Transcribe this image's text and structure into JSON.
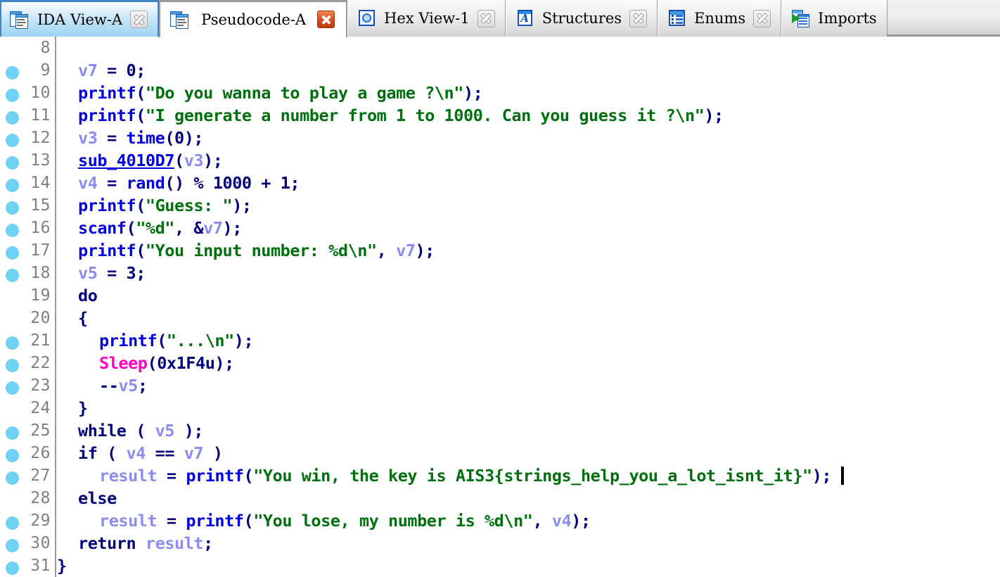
{
  "app": {
    "name": "IDA Pro disassembler",
    "active_tab": "Pseudocode-A"
  },
  "tabs": [
    {
      "id": "ida-view-a",
      "label": "IDA View-A",
      "icon": "document-stack-icon",
      "state": "hover",
      "close_style": "grey",
      "has_close": true
    },
    {
      "id": "pseudocode-a",
      "label": "Pseudocode-A",
      "icon": "document-stack-icon",
      "state": "active",
      "close_style": "red",
      "has_close": true
    },
    {
      "id": "hex-view-1",
      "label": "Hex View-1",
      "icon": "hex-view-icon",
      "state": "inactive",
      "close_style": "grey",
      "has_close": true
    },
    {
      "id": "structures",
      "label": "Structures",
      "icon": "structures-icon",
      "state": "inactive",
      "close_style": "grey",
      "has_close": true
    },
    {
      "id": "enums",
      "label": "Enums",
      "icon": "enums-icon",
      "state": "inactive",
      "close_style": "grey",
      "has_close": true
    },
    {
      "id": "imports",
      "label": "Imports",
      "icon": "imports-icon",
      "state": "inactive",
      "close_style": "grey",
      "has_close": false
    }
  ],
  "colors": {
    "keyword": "#00007f",
    "function": "#0000e0",
    "string": "#00700f",
    "variable": "#8c8cf0",
    "api_import": "#ff00c0",
    "line_number": "#808080",
    "breakpoint_dot": "#6fd2f5",
    "background": "#ffffff"
  },
  "editor": {
    "caret_visible": true,
    "caret_line": 27,
    "first_visible_line": 8,
    "last_visible_line": 31
  },
  "code_lines": [
    {
      "num": "8",
      "dot": false,
      "indent": 0,
      "tokens": []
    },
    {
      "num": "9",
      "dot": true,
      "indent": 2,
      "tokens": [
        {
          "t": "v7",
          "c": "c-var"
        },
        {
          "t": " = ",
          "c": "c-punct"
        },
        {
          "t": "0",
          "c": "c-num"
        },
        {
          "t": ";",
          "c": "c-punct"
        }
      ]
    },
    {
      "num": "10",
      "dot": true,
      "indent": 2,
      "tokens": [
        {
          "t": "printf",
          "c": "c-func"
        },
        {
          "t": "(",
          "c": "c-punct"
        },
        {
          "t": "\"Do you wanna to play a game ?\\n\"",
          "c": "c-str"
        },
        {
          "t": ");",
          "c": "c-punct"
        }
      ]
    },
    {
      "num": "11",
      "dot": true,
      "indent": 2,
      "tokens": [
        {
          "t": "printf",
          "c": "c-func"
        },
        {
          "t": "(",
          "c": "c-punct"
        },
        {
          "t": "\"I generate a number from 1 to 1000. Can you guess it ?\\n\"",
          "c": "c-str"
        },
        {
          "t": ");",
          "c": "c-punct"
        }
      ]
    },
    {
      "num": "12",
      "dot": true,
      "indent": 2,
      "tokens": [
        {
          "t": "v3",
          "c": "c-var"
        },
        {
          "t": " = ",
          "c": "c-punct"
        },
        {
          "t": "time",
          "c": "c-func"
        },
        {
          "t": "(",
          "c": "c-punct"
        },
        {
          "t": "0",
          "c": "c-num"
        },
        {
          "t": ");",
          "c": "c-punct"
        }
      ]
    },
    {
      "num": "13",
      "dot": true,
      "indent": 2,
      "tokens": [
        {
          "t": "sub_4010D7",
          "c": "c-subr"
        },
        {
          "t": "(",
          "c": "c-punct"
        },
        {
          "t": "v3",
          "c": "c-var"
        },
        {
          "t": ");",
          "c": "c-punct"
        }
      ]
    },
    {
      "num": "14",
      "dot": true,
      "indent": 2,
      "tokens": [
        {
          "t": "v4",
          "c": "c-var"
        },
        {
          "t": " = ",
          "c": "c-punct"
        },
        {
          "t": "rand",
          "c": "c-func"
        },
        {
          "t": "() % ",
          "c": "c-punct"
        },
        {
          "t": "1000",
          "c": "c-num"
        },
        {
          "t": " + ",
          "c": "c-punct"
        },
        {
          "t": "1",
          "c": "c-num"
        },
        {
          "t": ";",
          "c": "c-punct"
        }
      ]
    },
    {
      "num": "15",
      "dot": true,
      "indent": 2,
      "tokens": [
        {
          "t": "printf",
          "c": "c-func"
        },
        {
          "t": "(",
          "c": "c-punct"
        },
        {
          "t": "\"Guess: \"",
          "c": "c-str"
        },
        {
          "t": ");",
          "c": "c-punct"
        }
      ]
    },
    {
      "num": "16",
      "dot": true,
      "indent": 2,
      "tokens": [
        {
          "t": "scanf",
          "c": "c-func"
        },
        {
          "t": "(",
          "c": "c-punct"
        },
        {
          "t": "\"%d\"",
          "c": "c-str"
        },
        {
          "t": ", &",
          "c": "c-punct"
        },
        {
          "t": "v7",
          "c": "c-var"
        },
        {
          "t": ");",
          "c": "c-punct"
        }
      ]
    },
    {
      "num": "17",
      "dot": true,
      "indent": 2,
      "tokens": [
        {
          "t": "printf",
          "c": "c-func"
        },
        {
          "t": "(",
          "c": "c-punct"
        },
        {
          "t": "\"You input number: %d\\n\"",
          "c": "c-str"
        },
        {
          "t": ", ",
          "c": "c-punct"
        },
        {
          "t": "v7",
          "c": "c-var"
        },
        {
          "t": ");",
          "c": "c-punct"
        }
      ]
    },
    {
      "num": "18",
      "dot": true,
      "indent": 2,
      "tokens": [
        {
          "t": "v5",
          "c": "c-var"
        },
        {
          "t": " = ",
          "c": "c-punct"
        },
        {
          "t": "3",
          "c": "c-num"
        },
        {
          "t": ";",
          "c": "c-punct"
        }
      ]
    },
    {
      "num": "19",
      "dot": false,
      "indent": 2,
      "tokens": [
        {
          "t": "do",
          "c": "c-kw"
        }
      ]
    },
    {
      "num": "20",
      "dot": false,
      "indent": 2,
      "tokens": [
        {
          "t": "{",
          "c": "c-punct"
        }
      ]
    },
    {
      "num": "21",
      "dot": true,
      "indent": 4,
      "tokens": [
        {
          "t": "printf",
          "c": "c-func"
        },
        {
          "t": "(",
          "c": "c-punct"
        },
        {
          "t": "\"...\\n\"",
          "c": "c-str"
        },
        {
          "t": ");",
          "c": "c-punct"
        }
      ]
    },
    {
      "num": "22",
      "dot": true,
      "indent": 4,
      "tokens": [
        {
          "t": "Sleep",
          "c": "c-api"
        },
        {
          "t": "(",
          "c": "c-punct"
        },
        {
          "t": "0x1F4u",
          "c": "c-num"
        },
        {
          "t": ");",
          "c": "c-punct"
        }
      ]
    },
    {
      "num": "23",
      "dot": true,
      "indent": 4,
      "tokens": [
        {
          "t": "--",
          "c": "c-punct"
        },
        {
          "t": "v5",
          "c": "c-var"
        },
        {
          "t": ";",
          "c": "c-punct"
        }
      ]
    },
    {
      "num": "24",
      "dot": false,
      "indent": 2,
      "tokens": [
        {
          "t": "}",
          "c": "c-punct"
        }
      ]
    },
    {
      "num": "25",
      "dot": true,
      "indent": 2,
      "tokens": [
        {
          "t": "while",
          "c": "c-kw"
        },
        {
          "t": " ( ",
          "c": "c-punct"
        },
        {
          "t": "v5",
          "c": "c-var"
        },
        {
          "t": " );",
          "c": "c-punct"
        }
      ]
    },
    {
      "num": "26",
      "dot": true,
      "indent": 2,
      "tokens": [
        {
          "t": "if",
          "c": "c-kw"
        },
        {
          "t": " ( ",
          "c": "c-punct"
        },
        {
          "t": "v4",
          "c": "c-var"
        },
        {
          "t": " == ",
          "c": "c-punct"
        },
        {
          "t": "v7",
          "c": "c-var"
        },
        {
          "t": " )",
          "c": "c-punct"
        }
      ]
    },
    {
      "num": "27",
      "dot": true,
      "indent": 4,
      "tokens": [
        {
          "t": "result",
          "c": "c-var"
        },
        {
          "t": " = ",
          "c": "c-punct"
        },
        {
          "t": "printf",
          "c": "c-func"
        },
        {
          "t": "(",
          "c": "c-punct"
        },
        {
          "t": "\"You win, the key is AIS3{strings_help_you_a_lot_isnt_it}\"",
          "c": "c-str"
        },
        {
          "t": ");",
          "c": "c-punct"
        }
      ]
    },
    {
      "num": "28",
      "dot": false,
      "indent": 2,
      "tokens": [
        {
          "t": "else",
          "c": "c-kw"
        }
      ]
    },
    {
      "num": "29",
      "dot": true,
      "indent": 4,
      "tokens": [
        {
          "t": "result",
          "c": "c-var"
        },
        {
          "t": " = ",
          "c": "c-punct"
        },
        {
          "t": "printf",
          "c": "c-func"
        },
        {
          "t": "(",
          "c": "c-punct"
        },
        {
          "t": "\"You lose, my number is %d\\n\"",
          "c": "c-str"
        },
        {
          "t": ", ",
          "c": "c-punct"
        },
        {
          "t": "v4",
          "c": "c-var"
        },
        {
          "t": ");",
          "c": "c-punct"
        }
      ]
    },
    {
      "num": "30",
      "dot": true,
      "indent": 2,
      "tokens": [
        {
          "t": "return",
          "c": "c-kw"
        },
        {
          "t": " ",
          "c": "c-punct"
        },
        {
          "t": "result",
          "c": "c-var"
        },
        {
          "t": ";",
          "c": "c-punct"
        }
      ]
    },
    {
      "num": "31",
      "dot": true,
      "indent": 0,
      "tokens": [
        {
          "t": "}",
          "c": "c-punct"
        }
      ]
    }
  ]
}
